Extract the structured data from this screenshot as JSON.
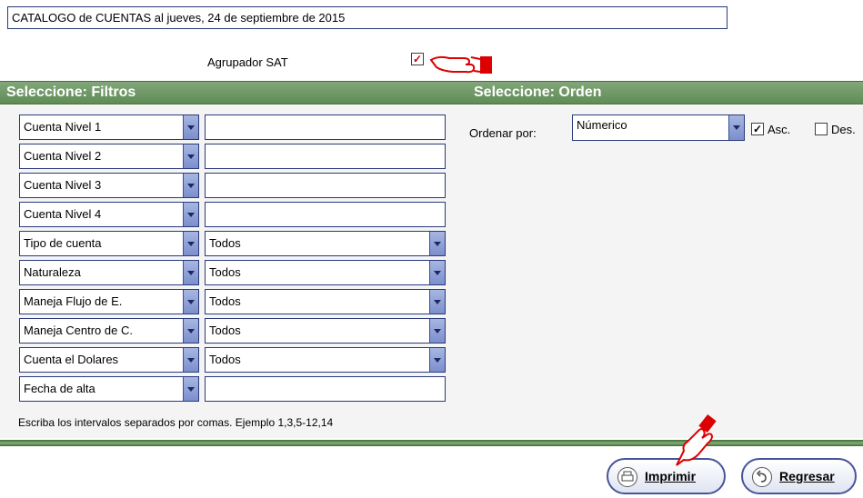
{
  "header": {
    "title": "CATALOGO de CUENTAS al jueves, 24 de septiembre de 2015"
  },
  "agrupador": {
    "label": "Agrupador SAT",
    "checked_mark": "✓"
  },
  "sections": {
    "filtros": "Seleccione: Filtros",
    "orden": "Seleccione: Orden"
  },
  "filters": [
    {
      "label": "Cuenta Nivel 1",
      "value": ""
    },
    {
      "label": "Cuenta Nivel 2",
      "value": ""
    },
    {
      "label": "Cuenta Nivel 3",
      "value": ""
    },
    {
      "label": "Cuenta Nivel 4",
      "value": ""
    },
    {
      "label": "Tipo de cuenta",
      "value": "Todos"
    },
    {
      "label": "Naturaleza",
      "value": "Todos"
    },
    {
      "label": "Maneja Flujo de E.",
      "value": "Todos"
    },
    {
      "label": "Maneja Centro de C.",
      "value": "Todos"
    },
    {
      "label": "Cuenta el Dolares",
      "value": "Todos"
    },
    {
      "label": "Fecha de alta",
      "value": ""
    }
  ],
  "order": {
    "label": "Ordenar por:",
    "value": "Númerico",
    "asc_label": "Asc.",
    "asc_checked": true,
    "asc_mark": "✓",
    "des_label": "Des."
  },
  "hint": "Escriba los intervalos separados por comas. Ejemplo 1,3,5-12,14",
  "buttons": {
    "print": "Imprimir",
    "back": "Regresar"
  },
  "icons": {
    "pointing_hand": "pointing-hand-icon",
    "printer": "printer-icon",
    "back_arrow": "back-arrow-icon"
  },
  "colors": {
    "section_header": "#6a9760",
    "field_border": "#2a3a7a",
    "dropdown_button": "#8a9bd4",
    "button_border": "#47549a"
  }
}
